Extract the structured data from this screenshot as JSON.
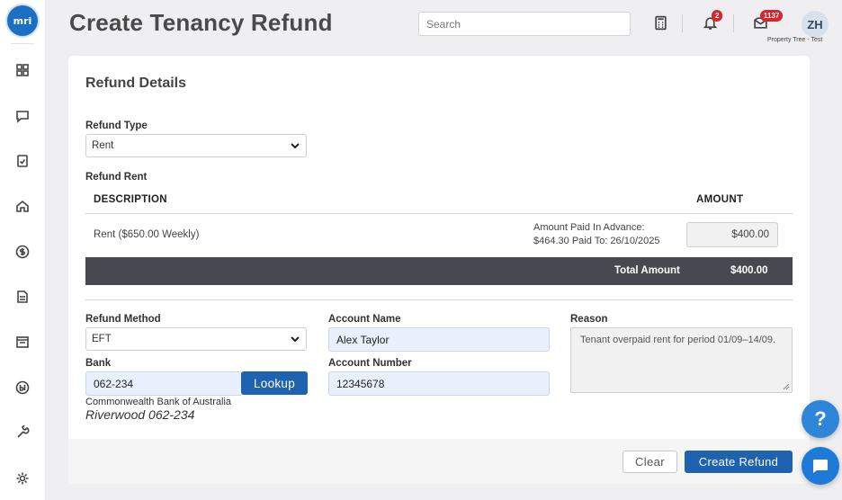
{
  "header": {
    "title": "Create Tenancy Refund",
    "search_placeholder": "Search",
    "notifications_count": "2",
    "messages_count": "1137",
    "avatar_initials": "ZH",
    "tenant_label": "Property Tree - Test"
  },
  "sidebar": {
    "logo_text": "mri",
    "items": [
      {
        "icon": "dashboard-icon"
      },
      {
        "icon": "chat-icon"
      },
      {
        "icon": "tasks-icon"
      },
      {
        "icon": "home-icon"
      },
      {
        "icon": "dollar-icon"
      },
      {
        "icon": "document-icon"
      },
      {
        "icon": "inbox-icon"
      },
      {
        "icon": "bi-icon"
      },
      {
        "icon": "wrench-icon"
      },
      {
        "icon": "settings-icon"
      }
    ]
  },
  "form": {
    "section_title": "Refund Details",
    "refund_type_label": "Refund Type",
    "refund_type_value": "Rent",
    "refund_rent_label": "Refund Rent",
    "table": {
      "col_description": "DESCRIPTION",
      "col_amount": "AMOUNT",
      "row_description": "Rent ($650.00 Weekly)",
      "paid_line1": "Amount Paid In Advance:",
      "paid_line2": "$464.30 Paid To: 26/10/2025",
      "row_amount": "$400.00"
    },
    "total_label": "Total Amount",
    "total_value": "$400.00",
    "refund_method_label": "Refund Method",
    "refund_method_value": "EFT",
    "bank_label": "Bank",
    "bank_value": "062-234",
    "lookup_label": "Lookup",
    "bank_name": "Commonwealth Bank of Australia",
    "bank_branch": "Riverwood 062-234",
    "account_name_label": "Account Name",
    "account_name_value": "Alex Taylor",
    "account_number_label": "Account Number",
    "account_number_value": "12345678",
    "reason_label": "Reason",
    "reason_value": "Tenant overpaid rent for period 01/09–14/09."
  },
  "footer": {
    "clear_label": "Clear",
    "create_label": "Create Refund"
  },
  "floating": {
    "help_label": "?"
  },
  "colors": {
    "primary": "#1f63b0",
    "badge": "#d9262c",
    "total_bar": "#464a50",
    "field_bg": "#e9f0fd"
  }
}
